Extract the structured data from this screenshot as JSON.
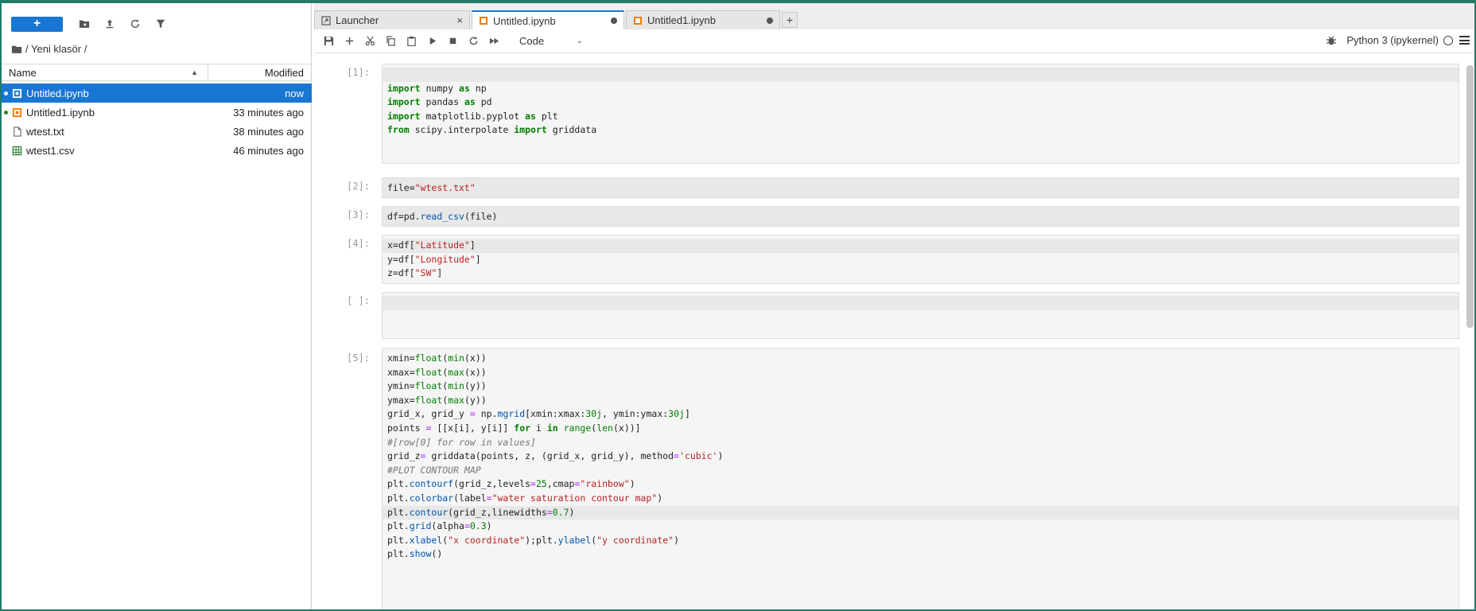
{
  "file_browser": {
    "new_label": "+",
    "breadcrumb": "/ Yeni klasör /",
    "col_name": "Name",
    "col_modified": "Modified",
    "files": [
      {
        "name": "Untitled.ipynb",
        "modified": "now",
        "icon": "notebook-icon",
        "running": true,
        "selected": true
      },
      {
        "name": "Untitled1.ipynb",
        "modified": "33 minutes ago",
        "icon": "notebook-icon",
        "running": true,
        "selected": false
      },
      {
        "name": "wtest.txt",
        "modified": "38 minutes ago",
        "icon": "text-file-icon",
        "running": false,
        "selected": false
      },
      {
        "name": "wtest1.csv",
        "modified": "46 minutes ago",
        "icon": "spreadsheet-icon",
        "running": false,
        "selected": false
      }
    ]
  },
  "tabs": [
    {
      "label": "Launcher",
      "icon": "launcher-icon",
      "active": false,
      "close": "×"
    },
    {
      "label": "Untitled.ipynb",
      "icon": "notebook-icon",
      "active": true,
      "close": "●"
    },
    {
      "label": "Untitled1.ipynb",
      "icon": "notebook-icon",
      "active": false,
      "close": "●"
    }
  ],
  "tab_add": "+",
  "notebook_toolbar": {
    "cell_type": "Code",
    "kernel": "Python 3 (ipykernel)"
  },
  "colors": {
    "accent": "#1976d2",
    "running_dot": "#2e7d32",
    "frame": "#217a6a"
  },
  "cells": [
    {
      "prompt": "[1]:",
      "lines": [
        "",
        "import numpy as np",
        "import pandas as pd",
        "import matplotlib.pyplot as plt",
        "from scipy.interpolate import griddata",
        "",
        ""
      ]
    },
    {
      "prompt": "[2]:",
      "lines": [
        "file=\"wtest.txt\""
      ]
    },
    {
      "prompt": "[3]:",
      "lines": [
        "df=pd.read_csv(file)"
      ]
    },
    {
      "prompt": "[4]:",
      "lines": [
        "x=df[\"Latitude\"]",
        "y=df[\"Longitude\"]",
        "z=df[\"SW\"]"
      ]
    },
    {
      "prompt": "[ ]:",
      "lines": [
        "",
        "",
        ""
      ]
    },
    {
      "prompt": "[5]:",
      "lines": [
        "xmin=float(min(x))",
        "xmax=float(max(x))",
        "ymin=float(min(y))",
        "ymax=float(max(y))",
        "grid_x, grid_y = np.mgrid[xmin:xmax:30j, ymin:ymax:30j]",
        "points = [[x[i], y[i]] for i in range(len(x))]",
        "#[row[0] for row in values]",
        "grid_z= griddata(points, z, (grid_x, grid_y), method='cubic')",
        "#PLOT CONTOUR MAP",
        "plt.contourf(grid_z,levels=25,cmap=\"rainbow\")",
        "plt.colorbar(label=\"water saturation contour map\")",
        "plt.contour(grid_z,linewidths=0.7)",
        "plt.grid(alpha=0.3)",
        "plt.xlabel(\"x coordinate\");plt.ylabel(\"y coordinate\")",
        "plt.show()",
        "",
        "",
        ""
      ]
    }
  ]
}
